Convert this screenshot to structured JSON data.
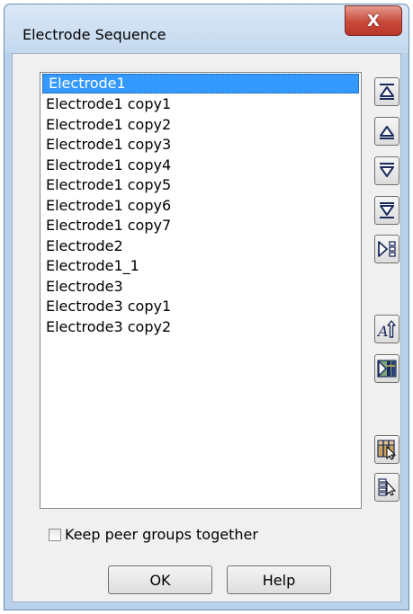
{
  "window": {
    "title": "Electrode Sequence",
    "close_glyph": "X"
  },
  "list": {
    "items": [
      "Electrode1",
      "Electrode1 copy1",
      "Electrode1 copy2",
      "Electrode1 copy3",
      "Electrode1 copy4",
      "Electrode1 copy5",
      "Electrode1 copy6",
      "Electrode1 copy7",
      "Electrode2",
      "Electrode1_1",
      "Electrode3",
      "Electrode3 copy1",
      "Electrode3 copy2"
    ],
    "selected_index": 0
  },
  "toolbar": {
    "icons": [
      "move-to-top-icon",
      "move-up-icon",
      "move-down-icon",
      "move-to-bottom-icon",
      "sequence-tree-icon",
      "sort-alphabetical-icon",
      "sort-by-position-icon",
      "pick-table-icon",
      "pick-list-icon"
    ]
  },
  "options": {
    "keep_peer_groups_label": "Keep peer groups together",
    "keep_peer_groups_checked": false
  },
  "buttons": {
    "ok_label": "OK",
    "help_label": "Help"
  },
  "colors": {
    "selection": "#3399ff",
    "close": "#c8493a"
  }
}
